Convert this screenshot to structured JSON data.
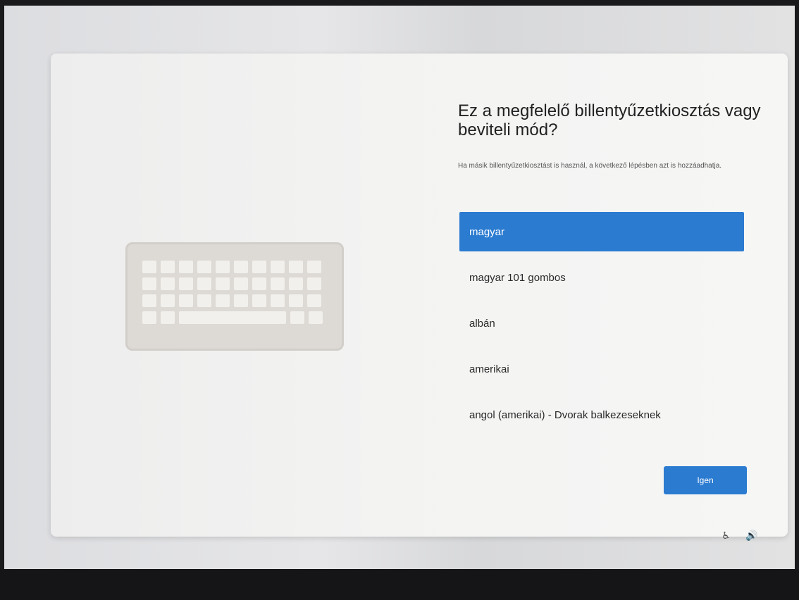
{
  "dialog": {
    "title": "Ez a megfelelő billentyűzetkiosztás vagy beviteli mód?",
    "subtitle": "Ha másik billentyűzetkiosztást is használ, a következő lépésben azt is hozzáadhatja."
  },
  "layouts": [
    {
      "label": "magyar",
      "selected": true
    },
    {
      "label": "magyar 101 gombos",
      "selected": false
    },
    {
      "label": "albán",
      "selected": false
    },
    {
      "label": "amerikai",
      "selected": false
    },
    {
      "label": "angol (amerikai) - Dvorak balkezeseknek",
      "selected": false
    }
  ],
  "actions": {
    "yes_label": "Igen"
  },
  "system_tray": {
    "accessibility_icon": "accessibility-icon",
    "volume_icon": "volume-icon"
  },
  "colors": {
    "accent": "#2b7bd1"
  }
}
